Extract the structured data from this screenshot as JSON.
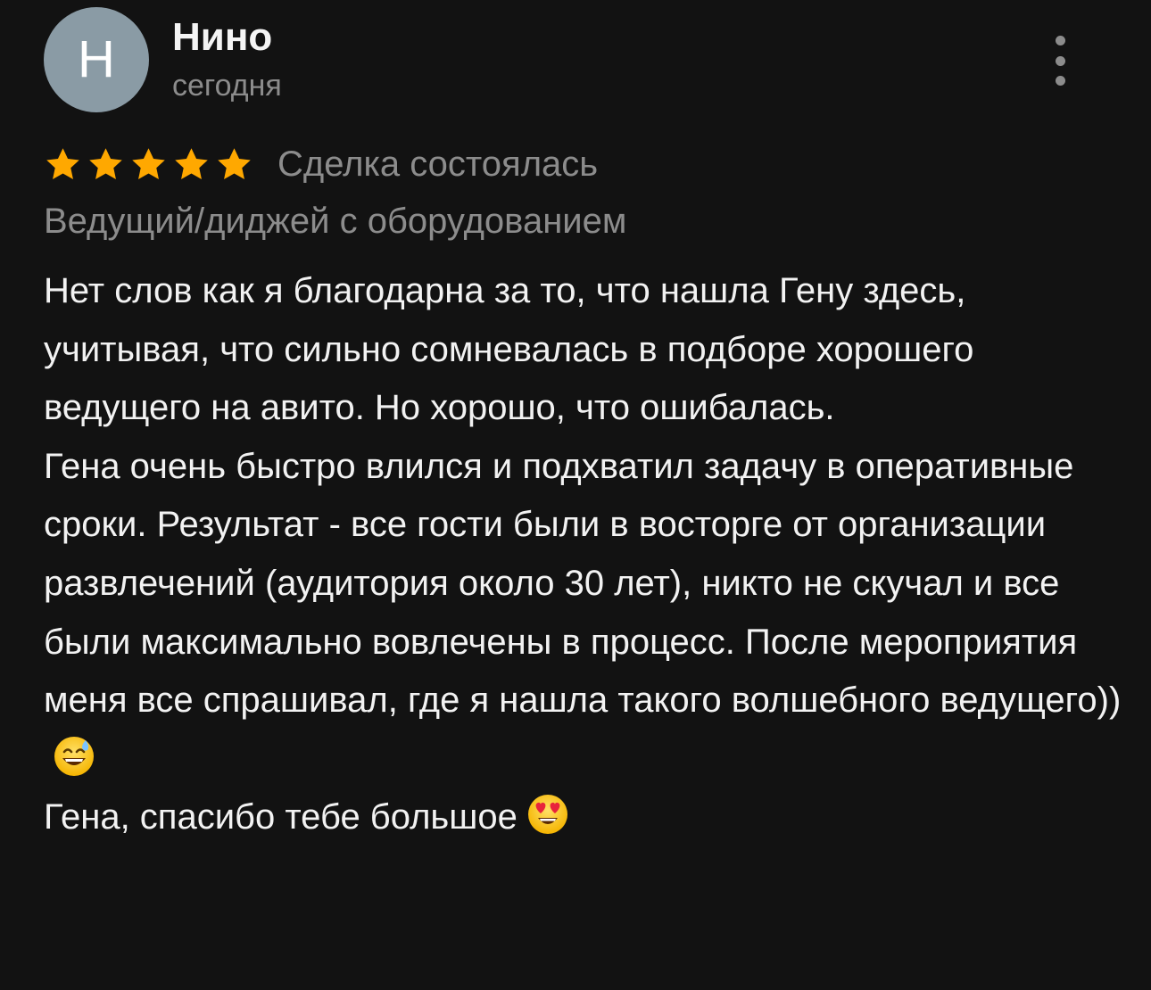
{
  "review": {
    "avatar_letter": "Н",
    "author_name": "Нино",
    "date": "сегодня",
    "rating": 5,
    "rating_max": 5,
    "deal_status": "Сделка состоялась",
    "service": "Ведущий/диджей с оборудованием",
    "paragraphs": [
      "Нет слов как я благодарна за то, что нашла Гену здесь, учитывая, что сильно сомневалась в подборе хорошего ведущего на авито. Но хорошо, что ошибалась.",
      "Гена очень быстро влился и подхватил задачу в оперативные сроки. Результат - все гости были в восторге от организации развлечений (аудитория около 30 лет), никто не скучал и все были максимально вовлечены в процесс. После мероприятия меня все спрашивал, где я нашла такого волшебного ведущего))",
      "Гена, спасибо тебе большое"
    ],
    "emojis": [
      "grinning-sweat-emoji",
      "heart-eyes-emoji"
    ]
  },
  "colors": {
    "background": "#121212",
    "star": "#ffa800",
    "secondary_text": "#8c8c8c",
    "avatar_bg": "#8a9ba5"
  },
  "icons": {
    "more": "more-vertical-icon",
    "star": "star-icon"
  }
}
